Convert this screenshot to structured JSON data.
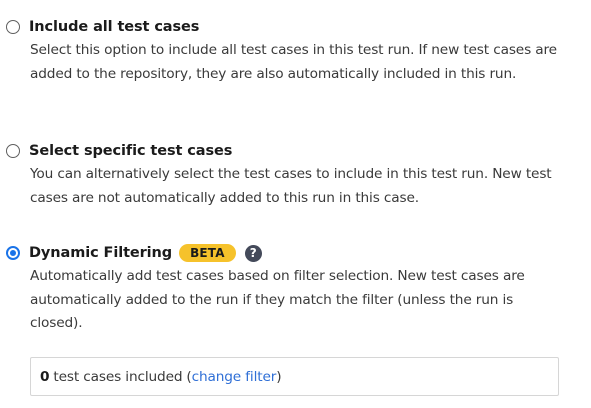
{
  "options": [
    {
      "title": "Include all test cases",
      "description": "Select this option to include all test cases in this test run. If new test cases are added to the repository, they are also automatically included in this run.",
      "selected": false
    },
    {
      "title": "Select specific test cases",
      "description": "You can alternatively select the test cases to include in this test run. New test cases are not automatically added to this run in this case.",
      "selected": false
    },
    {
      "title": "Dynamic Filtering",
      "badge": "BETA",
      "help_icon": "question-circle",
      "description": "Automatically add test cases based on filter selection. New test cases are automatically added to the run if they match the filter (unless the run is closed).",
      "selected": true
    }
  ],
  "filter_summary": {
    "count": "0",
    "text": "test cases included",
    "open_paren": "(",
    "link": "change filter",
    "close_paren": ")"
  },
  "colors": {
    "radio_selected": "#1a73e8",
    "badge_bg": "#f6c22b",
    "link": "#2f6fd6",
    "help_icon_bg": "#444a5a"
  }
}
